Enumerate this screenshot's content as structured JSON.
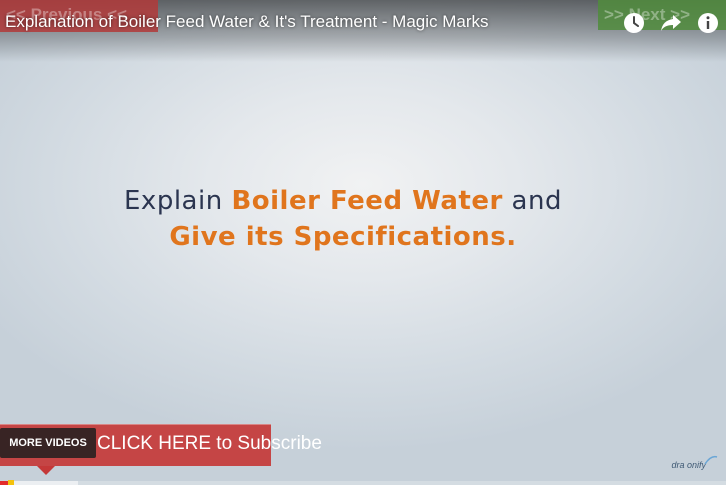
{
  "video": {
    "title": "Explanation of Boiler Feed Water & It's Treatment - Magic Marks"
  },
  "overlay": {
    "prev_label": "<< Previous <<",
    "next_label": ">> Next >>",
    "subscribe_label": "CLICK HERE to Subscribe",
    "more_videos_label": "MORE VIDEOS"
  },
  "controls": {
    "icons": [
      "clock-icon",
      "share-icon",
      "info-icon"
    ]
  },
  "slide": {
    "line1_prefix": "Explain ",
    "line1_highlight": "Boiler Feed Water",
    "line1_suffix": " and",
    "line2_highlight": "Give its Specifications."
  },
  "watermark": {
    "text": "dra onify"
  },
  "progress": {
    "played_fraction": 0.014,
    "loaded_fraction": 0.107
  },
  "colors": {
    "highlight": "#e0751d",
    "slide_text": "#2b3550",
    "subscribe_banner": "#c43838",
    "prev_button": "#b23a3a",
    "next_button": "#508c3c",
    "progress_played": "#e22b2b"
  }
}
